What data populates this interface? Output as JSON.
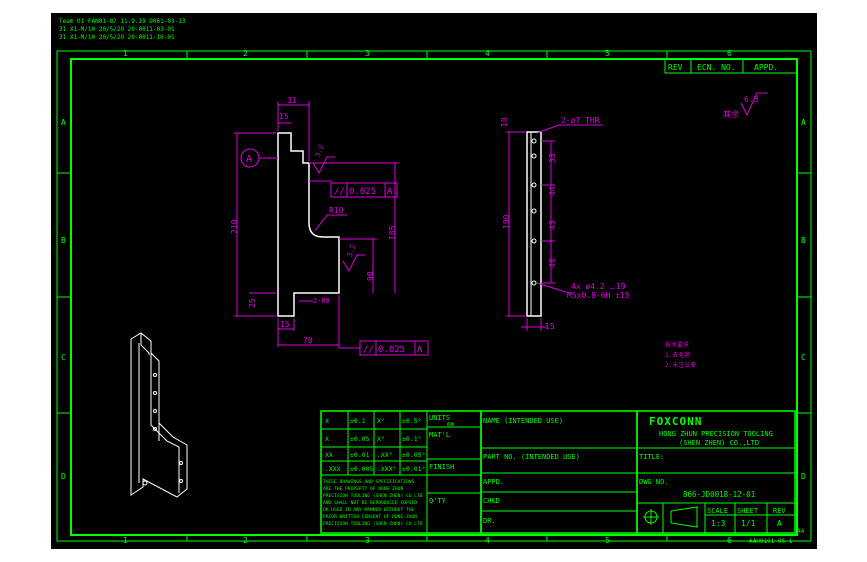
{
  "notes": {
    "line1": "Team 01 FAN01-87 11.9.19 D061-03-13",
    "line2": "31 X1-M/10 20/5/20 20-0011-03-01",
    "line3": "31 X1-M/10 20/5/20 20-0011-10-01"
  },
  "zones": {
    "columns": [
      "1",
      "2",
      "3",
      "4",
      "5",
      "6"
    ],
    "rows": [
      "A",
      "B",
      "C",
      "D"
    ]
  },
  "revision": {
    "rev": "REV",
    "ecn": "ECN. NO.",
    "appd": "APPD."
  },
  "surface_finish": {
    "value": "6.3",
    "note": "其余"
  },
  "front_view": {
    "datum": "A",
    "dims": {
      "top_width": "31",
      "offset": "15",
      "height": "210",
      "mid_height": "185",
      "lower": "90",
      "bottom": "25",
      "base_width": "15",
      "length": "70",
      "radius": "R10",
      "rough1": "3.2",
      "rough2": "3.2",
      "slot": "2-R8"
    },
    "tolerance1": {
      "symbol": "//",
      "value": "0.025",
      "datum": "A"
    },
    "tolerance2": {
      "symbol": "//",
      "value": "0.025",
      "datum": "A"
    }
  },
  "side_view": {
    "dims": {
      "top": "10",
      "hole_note": "2-ø7 THR",
      "d1": "33",
      "d2": "44",
      "d3": "43",
      "d4": "40",
      "total": "190",
      "width": "15"
    },
    "hole_spec1": "4x ø4.2 ⌴19",
    "hole_spec2": "M5x0.8-6H ↧15"
  },
  "tech_notes": [
    "技术要求",
    "1.去毛刺",
    "2.未注公差"
  ],
  "tolerances": {
    "rows": [
      [
        "X",
        "±0.1",
        "X°",
        "±0.5°"
      ],
      [
        "X",
        "±0.05",
        "X°",
        "±0.1°"
      ],
      [
        "XX",
        "±0.01",
        ".XX°",
        "±0.05°"
      ],
      [
        ".XXX",
        "±0.005",
        ".XXX°",
        "±0.01°"
      ]
    ],
    "notice": [
      "THESE DRAWINGS AND SPECIFICATIONS",
      "ARE THE PROPERTY OF HONG ZHUN",
      "PRECISION TOOLING (SHEN ZHEN) CO LTD",
      "AND SHALL NOT BE REPRODUCED COPIED",
      "OR USED IN ANY MANNER WITHOUT THE",
      "PRIOR WRITTEN CONSENT OF HONG ZHUN",
      "PRECISION TOOLING (SHEN ZHEN) CO LTD"
    ]
  },
  "labels": {
    "units": "UNITS",
    "units_value": "mm",
    "matl": "MAT'L",
    "finish": "FINISH",
    "qty": "Q'TY",
    "name": "NAME (INTENDED USE)",
    "part_no": "PART NO. (INTENDED USE)",
    "appd": "APPD.",
    "chkd": "CHKD",
    "dr": "DR.",
    "title": "TITLE:",
    "dwg_no": "DWG NO.",
    "scale": "SCALE",
    "sheet": "SHEET",
    "rev": "REV"
  },
  "company": {
    "brand": "FOXCONN",
    "name1": "HONG ZHUN PRECISION TOOLING",
    "name2": "(SHEN ZHEN) CO.,LTD"
  },
  "drawing": {
    "dwg_number": "866-JD0018-12-01",
    "scale_value": "1:3",
    "sheet_value": "1/1",
    "rev_value": "A",
    "form_code": "AAH0101-05-1",
    "size": "A4"
  },
  "colors": {
    "frame": "#00ff00",
    "dimension": "#e000e0",
    "geometry": "#ffffff",
    "background": "#000000"
  }
}
